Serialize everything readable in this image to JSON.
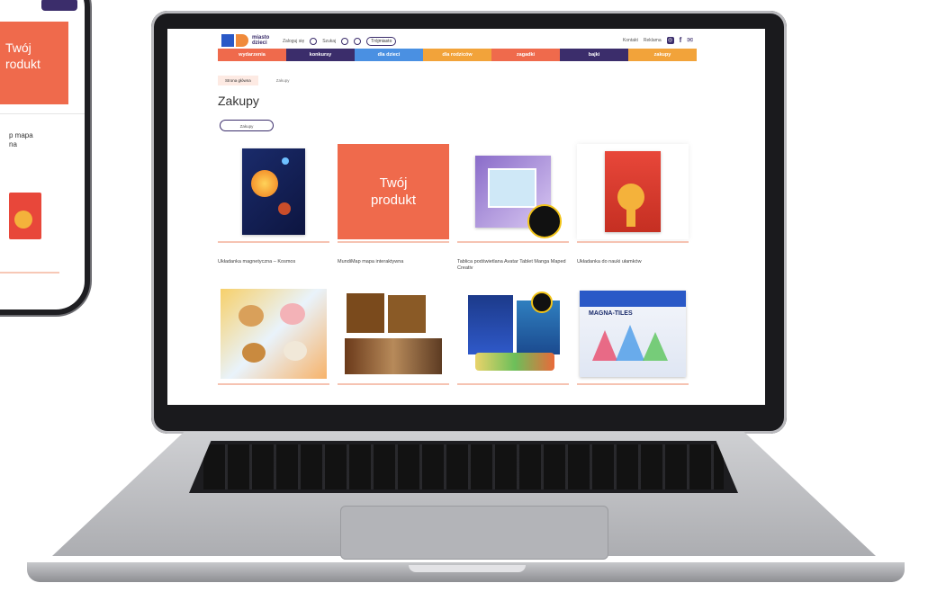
{
  "phone": {
    "card_line1": "Twój",
    "card_line2": "rodukt",
    "text_line1": "p mapa",
    "text_line2": "na"
  },
  "site": {
    "logo_text_line1": "miasto",
    "logo_text_line2": "dzieci",
    "header": {
      "login": "Zaloguj się",
      "search": "Szukaj",
      "location_pill": "Trójmiasto",
      "contact": "Kontakt",
      "ads": "Reklama"
    },
    "nav": [
      {
        "label": "wydarzenia",
        "color": "#ef6a4c"
      },
      {
        "label": "konkursy",
        "color": "#3b2d6b"
      },
      {
        "label": "dla dzieci",
        "color": "#4a90e2"
      },
      {
        "label": "dla rodziców",
        "color": "#f2a33a"
      },
      {
        "label": "zagadki",
        "color": "#ef6a4c"
      },
      {
        "label": "bajki",
        "color": "#3b2d6b"
      },
      {
        "label": "zakupy",
        "color": "#f2a33a"
      }
    ],
    "breadcrumb": {
      "home": "Strona główna",
      "current": "Zakupy"
    },
    "page_title": "Zakupy",
    "filter_button": "Zakupy",
    "products": [
      {
        "name": "Układanka magnetyczna – Kosmos",
        "icon": "space-puzzle-box"
      },
      {
        "name": "MundiMap mapa interaktywna",
        "placeholder_line1": "Twój",
        "placeholder_line2": "produkt"
      },
      {
        "name": "Tablica podświetlana Avatar Tablet Manga Maped Creativ",
        "icon": "light-tablet-box"
      },
      {
        "name": "Układanka do nauki ułamków",
        "icon": "fraction-puzzle-box"
      },
      {
        "name": "",
        "icon": "animal-puzzle-set"
      },
      {
        "name": "",
        "icon": "harry-potter-book-set"
      },
      {
        "name": "",
        "icon": "construction-kit-box"
      },
      {
        "name": "",
        "icon": "magna-tiles-box"
      }
    ],
    "magna_tiles_label": "MAGNA-TILES"
  }
}
